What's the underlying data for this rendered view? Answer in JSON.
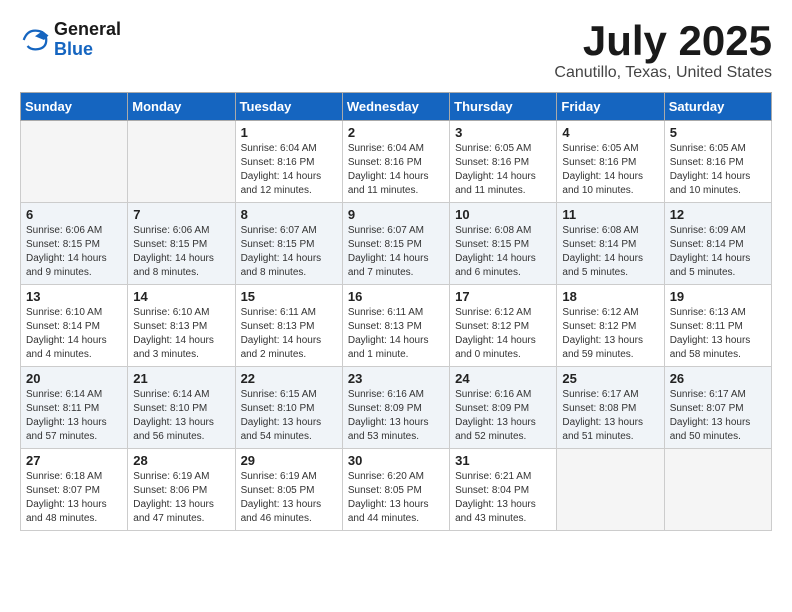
{
  "header": {
    "logo_general": "General",
    "logo_blue": "Blue",
    "month_title": "July 2025",
    "location": "Canutillo, Texas, United States"
  },
  "weekdays": [
    "Sunday",
    "Monday",
    "Tuesday",
    "Wednesday",
    "Thursday",
    "Friday",
    "Saturday"
  ],
  "weeks": [
    [
      {
        "day": "",
        "sunrise": "",
        "sunset": "",
        "daylight": ""
      },
      {
        "day": "",
        "sunrise": "",
        "sunset": "",
        "daylight": ""
      },
      {
        "day": "1",
        "sunrise": "Sunrise: 6:04 AM",
        "sunset": "Sunset: 8:16 PM",
        "daylight": "Daylight: 14 hours and 12 minutes."
      },
      {
        "day": "2",
        "sunrise": "Sunrise: 6:04 AM",
        "sunset": "Sunset: 8:16 PM",
        "daylight": "Daylight: 14 hours and 11 minutes."
      },
      {
        "day": "3",
        "sunrise": "Sunrise: 6:05 AM",
        "sunset": "Sunset: 8:16 PM",
        "daylight": "Daylight: 14 hours and 11 minutes."
      },
      {
        "day": "4",
        "sunrise": "Sunrise: 6:05 AM",
        "sunset": "Sunset: 8:16 PM",
        "daylight": "Daylight: 14 hours and 10 minutes."
      },
      {
        "day": "5",
        "sunrise": "Sunrise: 6:05 AM",
        "sunset": "Sunset: 8:16 PM",
        "daylight": "Daylight: 14 hours and 10 minutes."
      }
    ],
    [
      {
        "day": "6",
        "sunrise": "Sunrise: 6:06 AM",
        "sunset": "Sunset: 8:15 PM",
        "daylight": "Daylight: 14 hours and 9 minutes."
      },
      {
        "day": "7",
        "sunrise": "Sunrise: 6:06 AM",
        "sunset": "Sunset: 8:15 PM",
        "daylight": "Daylight: 14 hours and 8 minutes."
      },
      {
        "day": "8",
        "sunrise": "Sunrise: 6:07 AM",
        "sunset": "Sunset: 8:15 PM",
        "daylight": "Daylight: 14 hours and 8 minutes."
      },
      {
        "day": "9",
        "sunrise": "Sunrise: 6:07 AM",
        "sunset": "Sunset: 8:15 PM",
        "daylight": "Daylight: 14 hours and 7 minutes."
      },
      {
        "day": "10",
        "sunrise": "Sunrise: 6:08 AM",
        "sunset": "Sunset: 8:15 PM",
        "daylight": "Daylight: 14 hours and 6 minutes."
      },
      {
        "day": "11",
        "sunrise": "Sunrise: 6:08 AM",
        "sunset": "Sunset: 8:14 PM",
        "daylight": "Daylight: 14 hours and 5 minutes."
      },
      {
        "day": "12",
        "sunrise": "Sunrise: 6:09 AM",
        "sunset": "Sunset: 8:14 PM",
        "daylight": "Daylight: 14 hours and 5 minutes."
      }
    ],
    [
      {
        "day": "13",
        "sunrise": "Sunrise: 6:10 AM",
        "sunset": "Sunset: 8:14 PM",
        "daylight": "Daylight: 14 hours and 4 minutes."
      },
      {
        "day": "14",
        "sunrise": "Sunrise: 6:10 AM",
        "sunset": "Sunset: 8:13 PM",
        "daylight": "Daylight: 14 hours and 3 minutes."
      },
      {
        "day": "15",
        "sunrise": "Sunrise: 6:11 AM",
        "sunset": "Sunset: 8:13 PM",
        "daylight": "Daylight: 14 hours and 2 minutes."
      },
      {
        "day": "16",
        "sunrise": "Sunrise: 6:11 AM",
        "sunset": "Sunset: 8:13 PM",
        "daylight": "Daylight: 14 hours and 1 minute."
      },
      {
        "day": "17",
        "sunrise": "Sunrise: 6:12 AM",
        "sunset": "Sunset: 8:12 PM",
        "daylight": "Daylight: 14 hours and 0 minutes."
      },
      {
        "day": "18",
        "sunrise": "Sunrise: 6:12 AM",
        "sunset": "Sunset: 8:12 PM",
        "daylight": "Daylight: 13 hours and 59 minutes."
      },
      {
        "day": "19",
        "sunrise": "Sunrise: 6:13 AM",
        "sunset": "Sunset: 8:11 PM",
        "daylight": "Daylight: 13 hours and 58 minutes."
      }
    ],
    [
      {
        "day": "20",
        "sunrise": "Sunrise: 6:14 AM",
        "sunset": "Sunset: 8:11 PM",
        "daylight": "Daylight: 13 hours and 57 minutes."
      },
      {
        "day": "21",
        "sunrise": "Sunrise: 6:14 AM",
        "sunset": "Sunset: 8:10 PM",
        "daylight": "Daylight: 13 hours and 56 minutes."
      },
      {
        "day": "22",
        "sunrise": "Sunrise: 6:15 AM",
        "sunset": "Sunset: 8:10 PM",
        "daylight": "Daylight: 13 hours and 54 minutes."
      },
      {
        "day": "23",
        "sunrise": "Sunrise: 6:16 AM",
        "sunset": "Sunset: 8:09 PM",
        "daylight": "Daylight: 13 hours and 53 minutes."
      },
      {
        "day": "24",
        "sunrise": "Sunrise: 6:16 AM",
        "sunset": "Sunset: 8:09 PM",
        "daylight": "Daylight: 13 hours and 52 minutes."
      },
      {
        "day": "25",
        "sunrise": "Sunrise: 6:17 AM",
        "sunset": "Sunset: 8:08 PM",
        "daylight": "Daylight: 13 hours and 51 minutes."
      },
      {
        "day": "26",
        "sunrise": "Sunrise: 6:17 AM",
        "sunset": "Sunset: 8:07 PM",
        "daylight": "Daylight: 13 hours and 50 minutes."
      }
    ],
    [
      {
        "day": "27",
        "sunrise": "Sunrise: 6:18 AM",
        "sunset": "Sunset: 8:07 PM",
        "daylight": "Daylight: 13 hours and 48 minutes."
      },
      {
        "day": "28",
        "sunrise": "Sunrise: 6:19 AM",
        "sunset": "Sunset: 8:06 PM",
        "daylight": "Daylight: 13 hours and 47 minutes."
      },
      {
        "day": "29",
        "sunrise": "Sunrise: 6:19 AM",
        "sunset": "Sunset: 8:05 PM",
        "daylight": "Daylight: 13 hours and 46 minutes."
      },
      {
        "day": "30",
        "sunrise": "Sunrise: 6:20 AM",
        "sunset": "Sunset: 8:05 PM",
        "daylight": "Daylight: 13 hours and 44 minutes."
      },
      {
        "day": "31",
        "sunrise": "Sunrise: 6:21 AM",
        "sunset": "Sunset: 8:04 PM",
        "daylight": "Daylight: 13 hours and 43 minutes."
      },
      {
        "day": "",
        "sunrise": "",
        "sunset": "",
        "daylight": ""
      },
      {
        "day": "",
        "sunrise": "",
        "sunset": "",
        "daylight": ""
      }
    ]
  ]
}
